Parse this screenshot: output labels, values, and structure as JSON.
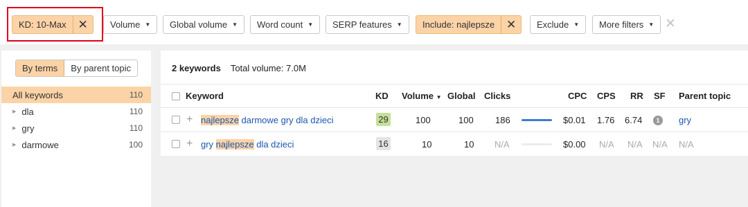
{
  "filters": {
    "kd_chip": "KD: 10-Max",
    "volume": "Volume",
    "global_volume": "Global volume",
    "word_count": "Word count",
    "serp_features": "SERP features",
    "include_chip": "Include: najlepsze",
    "exclude": "Exclude",
    "more_filters": "More filters",
    "close_glyph": "✕",
    "caret_glyph": "▼"
  },
  "sidebar": {
    "toggle": [
      "By terms",
      "By parent topic"
    ],
    "items": [
      {
        "label": "All keywords",
        "count": "110"
      },
      {
        "label": "dla",
        "count": "110"
      },
      {
        "label": "gry",
        "count": "110"
      },
      {
        "label": "darmowe",
        "count": "100"
      }
    ],
    "triangle_glyph": "▶"
  },
  "table": {
    "summary_count": "2 keywords",
    "summary_volume": "Total volume: 7.0M",
    "headers": {
      "keyword": "Keyword",
      "kd": "KD",
      "volume": "Volume",
      "sort_glyph": "▼",
      "global": "Global",
      "clicks": "Clicks",
      "cpc": "CPC",
      "cps": "CPS",
      "rr": "RR",
      "sf": "SF",
      "parent_topic": "Parent topic"
    },
    "rows": [
      {
        "kw_pre": "",
        "kw_hl": "najlepsze",
        "kw_post": " darmowe gry dla dzieci",
        "kd": "29",
        "volume": "100",
        "global": "100",
        "clicks": "186",
        "clicks_bar_fill": 1.0,
        "cpc": "$0.01",
        "cps": "1.76",
        "rr": "6.74",
        "sf": "1",
        "parent_topic": "gry"
      },
      {
        "kw_pre": "gry ",
        "kw_hl": "najlepsze",
        "kw_post": " dla dzieci",
        "kd": "16",
        "volume": "10",
        "global": "10",
        "clicks": "N/A",
        "clicks_bar_fill": 0.0,
        "cpc": "$0.00",
        "cps": "N/A",
        "rr": "N/A",
        "sf": "N/A",
        "parent_topic": "N/A"
      }
    ],
    "plus_glyph": "+"
  },
  "colors": {
    "highlight": "#fbd3a6",
    "link": "#1a55b0",
    "kd_29_bg": "#c5e09a",
    "kd_16_bg": "#e4e4e4",
    "clicks_bar": "#3a7bd5",
    "filter_outline": "#e0001a"
  }
}
